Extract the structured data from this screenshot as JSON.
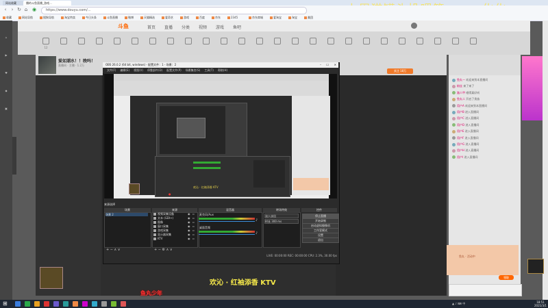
{
  "browser": {
    "tabs": [
      "网站收藏",
      "播的斗鱼直播_游戏..."
    ],
    "url": "https://www.douyu.com/...",
    "bookmarks": [
      "收藏",
      "网站导航",
      "搜狗导航",
      "淘宝特卖",
      "今日头条",
      "斗鱼直播",
      "微博",
      "天猫精选",
      "爱奇艺",
      "游戏",
      "百度",
      "京东",
      "2345",
      "京东商城",
      "爱淘宝",
      "淘宝",
      "美团"
    ]
  },
  "overlay": {
    "top_banner": "上周猫罐头投喂第一：一化化~~",
    "ktv_caption": "欢沁 · 红袖添香 KTV",
    "red_caption": "鱼丸少年"
  },
  "site": {
    "logo": "斗鱼",
    "nav": [
      "首页",
      "直播",
      "分类",
      "视频",
      "游戏",
      "鱼吧",
      "客户端"
    ],
    "icon_row": [
      "12",
      "",
      "",
      "",
      "",
      "",
      "",
      "",
      "",
      "",
      "",
      "",
      "",
      "",
      "",
      "",
      "",
      "",
      "",
      "",
      "",
      "",
      "",
      "",
      ""
    ]
  },
  "room": {
    "title": "爱如潮水！！晚吗！",
    "info": "直播间 · 主播 · 1.2万",
    "follow_label": "关注 18万"
  },
  "obs": {
    "title": "OBS 26.0.2 (64 bit, windows) - 配置文件：1 - 场景：2",
    "menu": [
      "文件(F)",
      "编辑(E)",
      "视图(V)",
      "停靠部件(D)",
      "配置文件(P)",
      "场景集合(S)",
      "工具(T)",
      "帮助(H)"
    ],
    "dock_label": "来源选择",
    "docks": {
      "scenes": "场景",
      "sources": "来源",
      "mixer": "混音器",
      "transitions": "转场特效",
      "controls": "控件"
    },
    "scenes": [
      "场景 2"
    ],
    "sources": [
      "视频采集设备",
      "文本 (GDI+)",
      "图像",
      "窗口采集",
      "游戏采集",
      "显示器采集",
      "KTV"
    ],
    "mixer": [
      {
        "name": "麦克风/Aux",
        "db": "0.0 dB"
      },
      {
        "name": "桌面音频",
        "db": "0.0 dB"
      }
    ],
    "transitions": [
      "淡入淡出",
      "时长 300 ms"
    ],
    "controls": [
      "停止直播",
      "开始录制",
      "启动虚拟摄像机",
      "工作室模式",
      "设置",
      "退出"
    ],
    "status": "LIVE: 00:00:00   REC: 00:00:00   CPU: 2.3%, 30.00 fps"
  },
  "inner": {
    "ktv": "欢沁 · 红袖添香 KTV"
  },
  "chat": {
    "lines": [
      {
        "name": "鱼丸一",
        "text": "欢迎来到本直播间"
      },
      {
        "name": "粉丝",
        "text": "来了来了"
      },
      {
        "name": "路人甲",
        "text": "唱得真好听"
      },
      {
        "name": "鱼丸二",
        "text": "开启了贵族"
      },
      {
        "name": "用户A",
        "text": "欢迎来到本直播间"
      },
      {
        "name": "用户B",
        "text": "进入直播间"
      },
      {
        "name": "用户C",
        "text": "进入直播间"
      },
      {
        "name": "用户D",
        "text": "进入直播间"
      },
      {
        "name": "用户E",
        "text": "进入直播间"
      },
      {
        "name": "用户F",
        "text": "进入直播间"
      },
      {
        "name": "用户G",
        "text": "进入直播间"
      },
      {
        "name": "用户H",
        "text": "进入直播间"
      },
      {
        "name": "用户I",
        "text": "进入直播间"
      }
    ],
    "gift_text": "鱼丸 · 活动中",
    "gift_button": "领取"
  },
  "taskbar": {
    "time": "18:51",
    "date": "2021/3/1"
  },
  "colors": {
    "accent": "#f07a2a",
    "overlay_yellow": "#f5e36a",
    "live_red": "#f33"
  }
}
